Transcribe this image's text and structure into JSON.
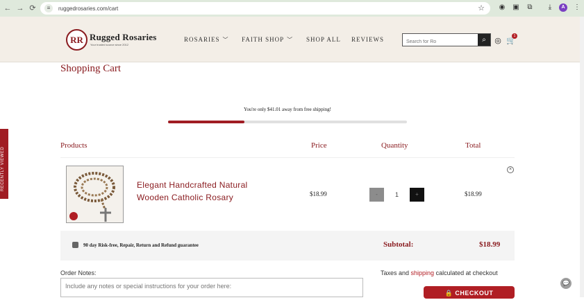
{
  "browser": {
    "url": "ruggedrosaries.com/cart",
    "profile_initial": "A"
  },
  "header": {
    "logo_monogram": "RR",
    "brand_name": "Rugged Rosaries",
    "brand_tagline": "Your trusted source since 2012",
    "nav": [
      {
        "label": "ROSARIES",
        "has_dropdown": true
      },
      {
        "label": "FAITH SHOP",
        "has_dropdown": true
      },
      {
        "label": "SHOP ALL",
        "has_dropdown": false
      },
      {
        "label": "REVIEWS",
        "has_dropdown": false
      }
    ],
    "search_placeholder": "Search for Ro",
    "cart_count": "1"
  },
  "cart": {
    "title": "Shopping Cart",
    "shipping_message": "You're only $41.01 away from free shipping!",
    "shipping_progress": 0.32,
    "columns": {
      "products": "Products",
      "price": "Price",
      "quantity": "Quantity",
      "total": "Total"
    },
    "items": [
      {
        "name": "Elegant Handcrafted Natural Wooden Catholic Rosary",
        "price": "$18.99",
        "quantity": "1",
        "total": "$18.99",
        "qty_minus": "-",
        "qty_plus": "+"
      }
    ],
    "guarantee": "90 day Risk-free, Repair, Return and Refund guarantee",
    "subtotal_label": "Subtotal:",
    "subtotal_value": "$18.99",
    "notes_label": "Order Notes:",
    "notes_placeholder": "Include any notes or special instructions for your order here:",
    "tax_prefix": "Taxes and ",
    "tax_link": "shipping",
    "tax_suffix": " calculated at checkout",
    "checkout_label": "CHECKOUT"
  },
  "side_tab": {
    "label": "RECENTLY VIEWED"
  },
  "colors": {
    "accent": "#8a1c20",
    "button": "#b01e24",
    "header_bg": "#f3eee7"
  }
}
